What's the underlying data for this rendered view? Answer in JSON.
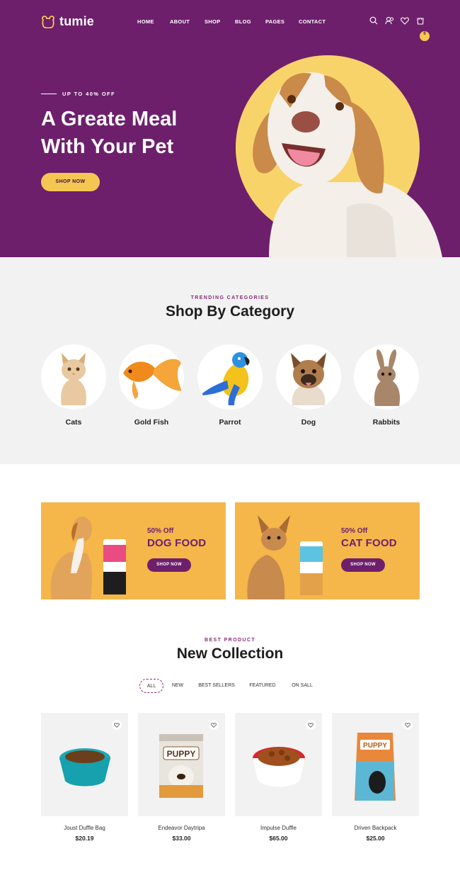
{
  "colors": {
    "hero_bg": "#6d1f6c",
    "accent_yellow": "#f6c653",
    "banner_bg": "#f5b64a",
    "category_bg": "#f2f2f2"
  },
  "brand": {
    "name": "tumie",
    "icon": "bear-face-icon"
  },
  "nav": {
    "items": [
      "HOME",
      "ABOUT",
      "SHOP",
      "BLOG",
      "PAGES",
      "CONTACT"
    ],
    "icons": [
      "search-icon",
      "user-icon",
      "heart-icon",
      "cart-icon"
    ],
    "cart_count": "0"
  },
  "hero": {
    "eyebrow": "UP TO 40% OFF",
    "title_line1": "A Greate Meal",
    "title_line2": "With Your Pet",
    "button": "SHOP NOW"
  },
  "categories": {
    "eyebrow": "TRENDING CATEGORIES",
    "title": "Shop By Category",
    "items": [
      {
        "label": "Cats",
        "icon": "cat-icon"
      },
      {
        "label": "Gold Fish",
        "icon": "goldfish-icon"
      },
      {
        "label": "Parrot",
        "icon": "parrot-icon"
      },
      {
        "label": "Dog",
        "icon": "dog-icon"
      },
      {
        "label": "Rabbits",
        "icon": "rabbit-icon"
      }
    ]
  },
  "banners": [
    {
      "discount": "50% Off",
      "title": "DOG FOOD",
      "button": "SHOP NOW"
    },
    {
      "discount": "50% Off",
      "title": "CAT FOOD",
      "button": "SHOP NOW"
    }
  ],
  "collection": {
    "eyebrow": "BEST PRODUCT",
    "title": "New Collection",
    "filters": [
      "ALL",
      "NEW",
      "BEST SELLERS",
      "FEATURED",
      "ON SALL"
    ],
    "active_filter": "ALL",
    "products": [
      {
        "name": "Joust Duffle Bag",
        "price": "$20.19"
      },
      {
        "name": "Endeavor Daytripa",
        "price": "$33.00"
      },
      {
        "name": "Impulse Duffle",
        "price": "$65.00"
      },
      {
        "name": "Driven Backpack",
        "price": "$25.00"
      }
    ]
  }
}
